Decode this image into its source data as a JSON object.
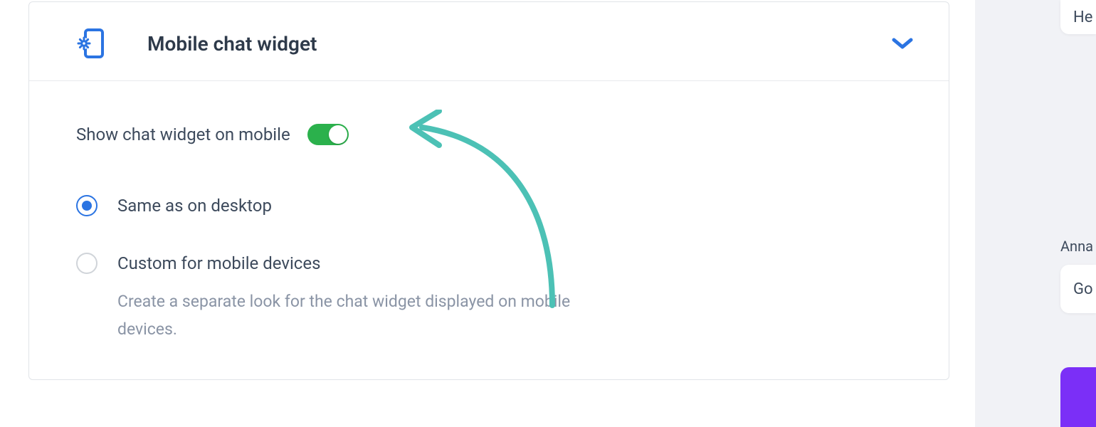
{
  "card": {
    "title": "Mobile chat widget",
    "toggle": {
      "label": "Show chat widget on mobile",
      "on": true
    },
    "options": [
      {
        "label": "Same as on desktop",
        "selected": true
      },
      {
        "label": "Custom for mobile devices",
        "selected": false,
        "description": "Create a separate look for the chat widget displayed on mobile devices."
      }
    ]
  },
  "preview": {
    "bubble_top_text": "He",
    "author_name": "Anna",
    "bubble_mid_text": "Go"
  },
  "colors": {
    "accent_blue": "#2b74e2",
    "toggle_green": "#2bb14c",
    "annotation_teal": "#4cc1b5",
    "preview_purple": "#7b2ff7"
  }
}
